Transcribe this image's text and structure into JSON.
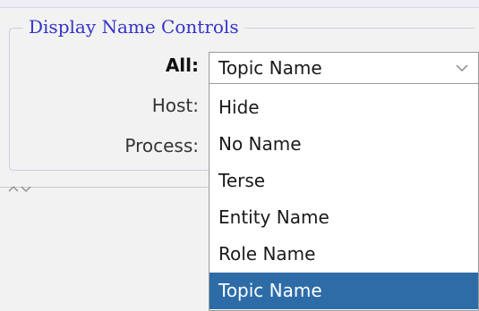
{
  "group": {
    "title": "Display Name Controls"
  },
  "rows": {
    "all_label": "All:",
    "host_label": "Host:",
    "process_label": "Process:"
  },
  "combo": {
    "selected_value": "Topic Name",
    "arrow_icon": "chevron-down-icon"
  },
  "dropdown": {
    "options": [
      {
        "label": "Hide"
      },
      {
        "label": "No Name"
      },
      {
        "label": "Terse"
      },
      {
        "label": "Entity Name"
      },
      {
        "label": "Role Name"
      },
      {
        "label": "Topic Name",
        "selected": true
      }
    ]
  },
  "splitter": {
    "icon": "collapse-expand-icon"
  },
  "colors": {
    "group_title": "#3434c8",
    "selection": "#2d6ca7",
    "group_border": "#cfcde6"
  }
}
